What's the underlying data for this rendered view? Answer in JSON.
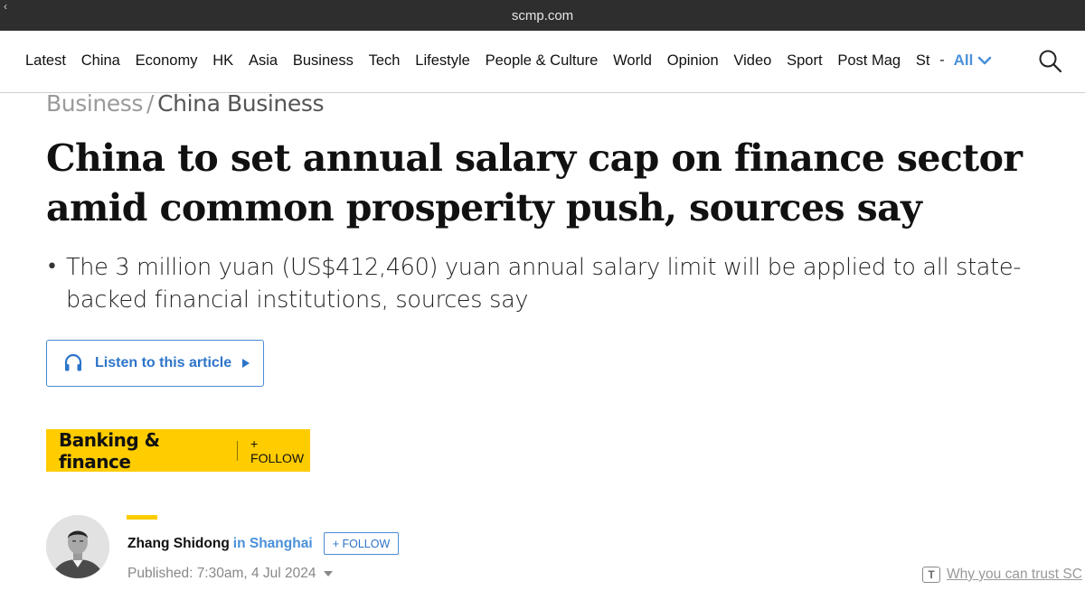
{
  "browser": {
    "url": "scmp.com"
  },
  "nav": {
    "items": [
      "Latest",
      "China",
      "Economy",
      "HK",
      "Asia",
      "Business",
      "Tech",
      "Lifestyle",
      "People & Culture",
      "World",
      "Opinion",
      "Video",
      "Sport",
      "Post Mag",
      "St"
    ],
    "dash": "-",
    "all_label": "All"
  },
  "breadcrumb": {
    "section": "Business",
    "separator": "/",
    "subsection": "China Business"
  },
  "article": {
    "headline": "China to set annual salary cap on finance sector amid common prosperity push, sources say",
    "summary": "The 3 million yuan (US$412,460) yuan annual salary limit will be applied to all state-backed financial institutions, sources say",
    "bullet": "•"
  },
  "listen": {
    "label": "Listen to this article"
  },
  "topic": {
    "name": "Banking & finance",
    "follow_label": "+ FOLLOW"
  },
  "author": {
    "name": "Zhang Shidong",
    "location": "in Shanghai",
    "follow_label": "+ FOLLOW"
  },
  "published": {
    "text": "Published: 7:30am, 4 Jul 2024"
  },
  "trust": {
    "icon_letter": "T",
    "link_text": "Why you can trust SC"
  },
  "colors": {
    "accent_blue": "#4a90d9",
    "topic_yellow": "#ffcc00",
    "browser_bar": "#2e2e2e"
  }
}
